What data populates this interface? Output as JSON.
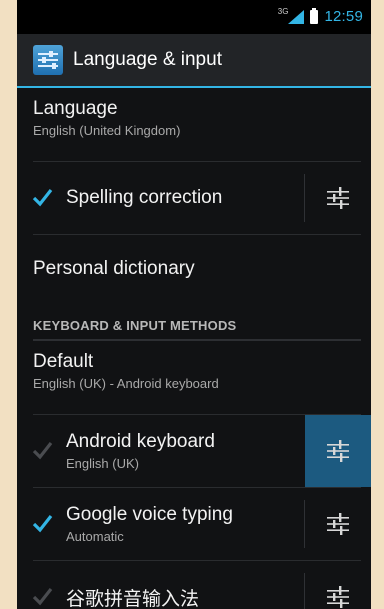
{
  "status_bar": {
    "network": "3G",
    "time": "12:59"
  },
  "action_bar": {
    "title": "Language & input",
    "icon": "settings-sliders-icon"
  },
  "language": {
    "title": "Language",
    "value": "English (United Kingdom)"
  },
  "spelling": {
    "label": "Spelling correction",
    "checked": true
  },
  "personal_dictionary": {
    "label": "Personal dictionary"
  },
  "section": {
    "header": "KEYBOARD & INPUT METHODS"
  },
  "default": {
    "title": "Default",
    "value": "English (UK) - Android keyboard"
  },
  "input_methods": [
    {
      "label": "Android keyboard",
      "summary": "English (UK)",
      "checked": true,
      "enabled": false,
      "pressed": true
    },
    {
      "label": "Google voice typing",
      "summary": "Automatic",
      "checked": true,
      "enabled": true,
      "pressed": false
    },
    {
      "label": "谷歌拼音输入法",
      "summary": "",
      "checked": true,
      "enabled": false,
      "pressed": false
    }
  ],
  "colors": {
    "accent": "#33b5e5",
    "background": "#111214",
    "pressed": "#1c5a80"
  }
}
